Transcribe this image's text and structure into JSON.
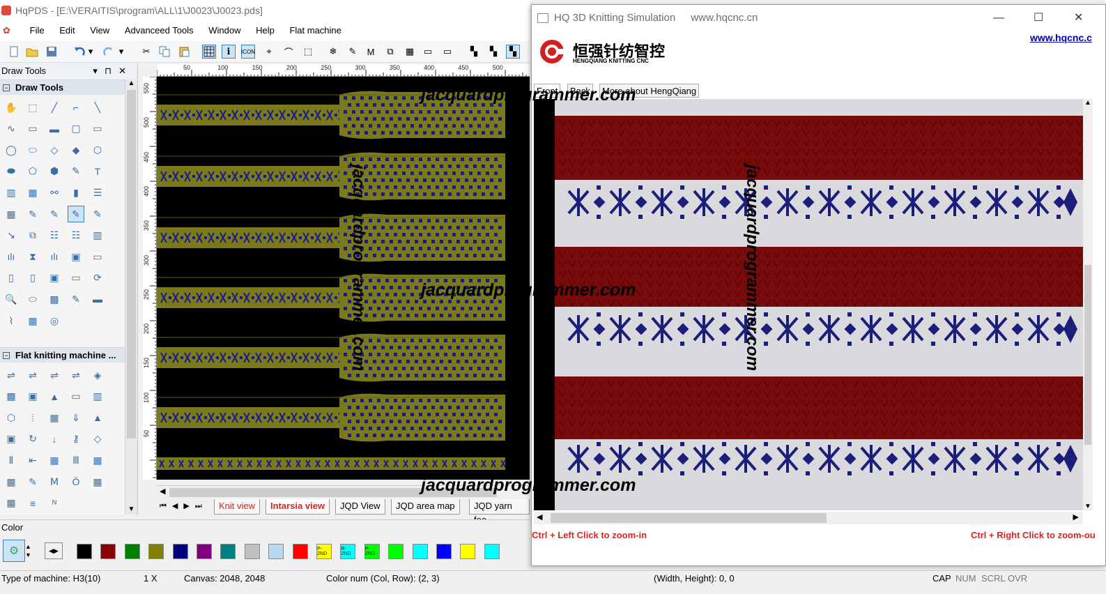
{
  "main_window": {
    "title": "HqPDS - [E:\\VERAITIS\\program\\ALL\\1\\J0023\\J0023.pds]",
    "menu": [
      "File",
      "Edit",
      "View",
      "Advanceed Tools",
      "Window",
      "Help",
      "Flat machine"
    ]
  },
  "left_panel": {
    "header": "Draw Tools",
    "section_draw": "Draw Tools",
    "section_flat": "Flat knitting machine ..."
  },
  "ruler": {
    "h_labels": [
      "50",
      "100",
      "150",
      "200",
      "250",
      "300",
      "350",
      "400",
      "450",
      "500"
    ],
    "v_labels": [
      "550",
      "500",
      "450",
      "400",
      "350",
      "300",
      "250",
      "200",
      "150",
      "100",
      "50"
    ]
  },
  "view_tabs": [
    "Knit view",
    "Intarsia view",
    "JQD View",
    "JQD area map",
    "JQD yarn fee"
  ],
  "color_panel": {
    "label": "Color",
    "swatches": [
      {
        "color": "#000000",
        "label": ""
      },
      {
        "color": "#8b0000",
        "label": ""
      },
      {
        "color": "#008000",
        "label": ""
      },
      {
        "color": "#808000",
        "label": ""
      },
      {
        "color": "#000080",
        "label": ""
      },
      {
        "color": "#800080",
        "label": ""
      },
      {
        "color": "#008080",
        "label": ""
      },
      {
        "color": "#c0c0c0",
        "label": ""
      },
      {
        "color": "#b9d7f0",
        "label": ""
      },
      {
        "color": "#ff0000",
        "label": ""
      },
      {
        "color": "#ffff00",
        "label": "P-2ND"
      },
      {
        "color": "#00ffff",
        "label": "R-2ND"
      },
      {
        "color": "#00ff00",
        "label": "P-2ND"
      },
      {
        "color": "#00ff00",
        "label": ""
      },
      {
        "color": "#00ffff",
        "label": ""
      },
      {
        "color": "#0000ff",
        "label": ""
      },
      {
        "color": "#ffff00",
        "label": ""
      },
      {
        "color": "#00ffff",
        "label": ""
      }
    ]
  },
  "status_bar": {
    "machine": "Type of machine: H3(10)",
    "zoom": "1 X",
    "canvas": "Canvas: 2048, 2048",
    "color_num": "Color num (Col, Row): (2, 3)",
    "size": "(Width, Height): 0, 0",
    "cap": "CAP",
    "num": "NUM",
    "scrl": "SCRL",
    "ovr": "OVR"
  },
  "sim_window": {
    "title": "HQ 3D Knitting Simulation",
    "url": "www.hqcnc.cn",
    "link": "www.hqcnc.c",
    "logo_cn": "恒强针纺智控",
    "logo_en": "HENGQIANG KNITTING CNC",
    "tabs": [
      "Front",
      "Back",
      "More about HengQiang"
    ],
    "hint_left": "Ctrl + Left Click to zoom-in",
    "hint_right": "Ctrl + Right Click to zoom-ou",
    "stripe_colors": {
      "red": "#7a0b0b",
      "white": "#d9d9de",
      "blue": "#1c1f7a"
    }
  },
  "watermark": {
    "text_h1": "jacquardprogrammer.com",
    "text_h2": "jacquardprogrammer.com",
    "text_h3": "jacquardprogrammer.com",
    "text_v1": "jacquardprogrammer.com",
    "text_v2": "jacquardprogrammer.com"
  },
  "colors": {
    "olive": "#7a7a1a",
    "navy": "#1a1a8a"
  }
}
